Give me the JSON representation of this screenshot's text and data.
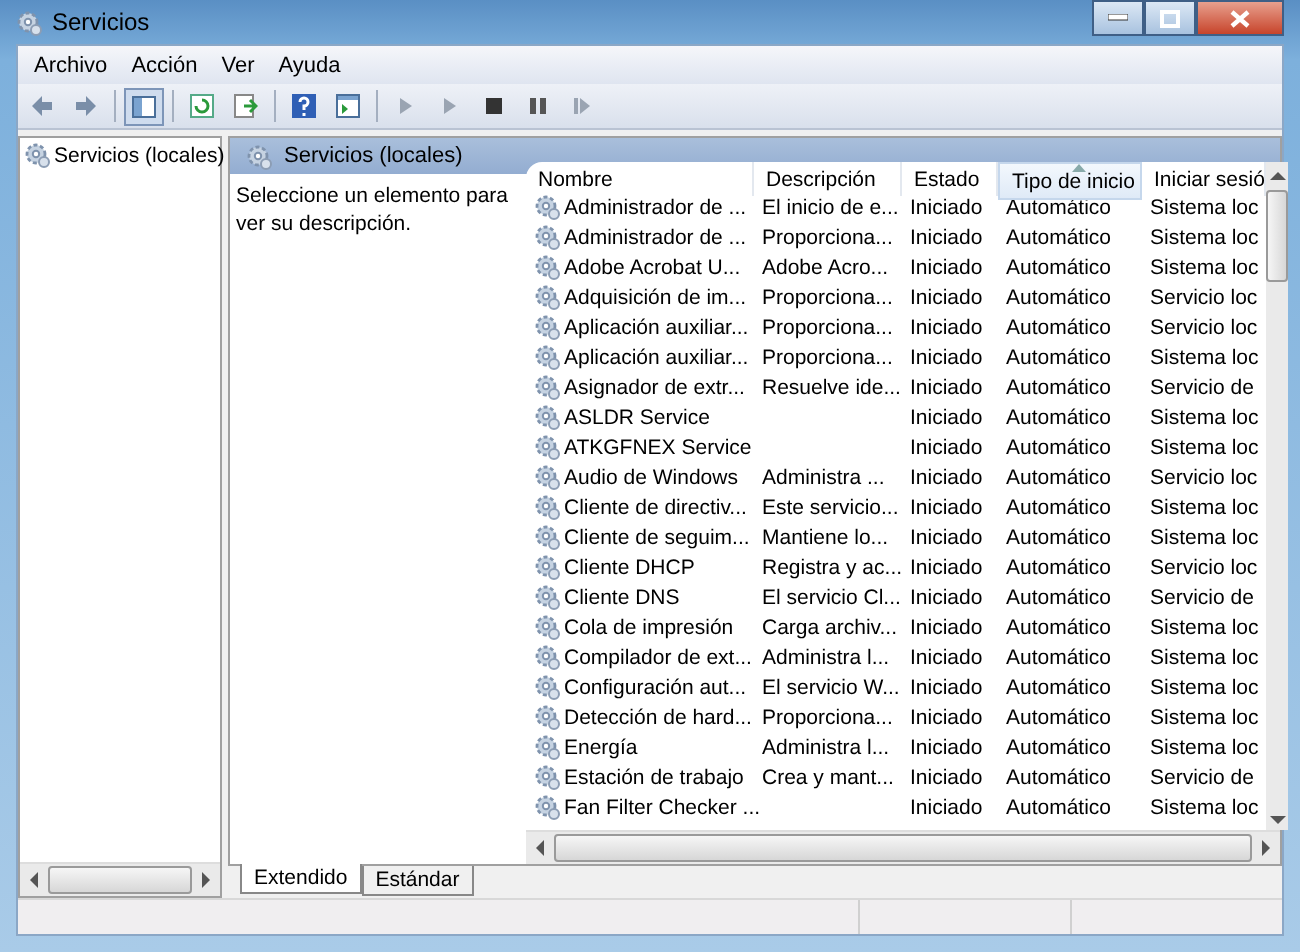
{
  "window": {
    "title": "Servicios"
  },
  "menu": [
    "Archivo",
    "Acción",
    "Ver",
    "Ayuda"
  ],
  "sidebar": {
    "items": [
      {
        "label": "Servicios (locales)",
        "selected": false
      }
    ]
  },
  "panel": {
    "title": "Servicios (locales)",
    "description": "Seleccione un elemento para ver su descripción."
  },
  "table": {
    "columns": [
      {
        "label": "Nombre",
        "sorted": false
      },
      {
        "label": "Descripción",
        "sorted": false
      },
      {
        "label": "Estado",
        "sorted": false
      },
      {
        "label": "Tipo de inicio",
        "sorted": true
      },
      {
        "label": "Iniciar sesió",
        "sorted": false
      }
    ],
    "rows": [
      {
        "name": "Administrador de ...",
        "description": "El inicio de e...",
        "status": "Iniciado",
        "startup": "Automático",
        "logon": "Sistema loc"
      },
      {
        "name": "Administrador de ...",
        "description": "Proporciona...",
        "status": "Iniciado",
        "startup": "Automático",
        "logon": "Sistema loc"
      },
      {
        "name": "Adobe Acrobat U...",
        "description": "Adobe Acro...",
        "status": "Iniciado",
        "startup": "Automático",
        "logon": "Sistema loc"
      },
      {
        "name": "Adquisición de im...",
        "description": "Proporciona...",
        "status": "Iniciado",
        "startup": "Automático",
        "logon": "Servicio loc"
      },
      {
        "name": "Aplicación auxiliar...",
        "description": "Proporciona...",
        "status": "Iniciado",
        "startup": "Automático",
        "logon": "Servicio loc"
      },
      {
        "name": "Aplicación auxiliar...",
        "description": "Proporciona...",
        "status": "Iniciado",
        "startup": "Automático",
        "logon": "Sistema loc"
      },
      {
        "name": "Asignador de extr...",
        "description": "Resuelve ide...",
        "status": "Iniciado",
        "startup": "Automático",
        "logon": "Servicio de"
      },
      {
        "name": "ASLDR Service",
        "status": "Iniciado",
        "startup": "Automático",
        "logon": "Sistema loc"
      },
      {
        "name": "ATKGFNEX Service",
        "status": "Iniciado",
        "startup": "Automático",
        "logon": "Sistema loc"
      },
      {
        "name": "Audio de Windows",
        "description": "Administra ...",
        "status": "Iniciado",
        "startup": "Automático",
        "logon": "Servicio loc"
      },
      {
        "name": "Cliente de directiv...",
        "description": "Este servicio...",
        "status": "Iniciado",
        "startup": "Automático",
        "logon": "Sistema loc"
      },
      {
        "name": "Cliente de seguim...",
        "description": "Mantiene lo...",
        "status": "Iniciado",
        "startup": "Automático",
        "logon": "Sistema loc"
      },
      {
        "name": "Cliente DHCP",
        "description": "Registra y ac...",
        "status": "Iniciado",
        "startup": "Automático",
        "logon": "Servicio loc"
      },
      {
        "name": "Cliente DNS",
        "description": "El servicio Cl...",
        "status": "Iniciado",
        "startup": "Automático",
        "logon": "Servicio de"
      },
      {
        "name": "Cola de impresión",
        "description": "Carga archiv...",
        "status": "Iniciado",
        "startup": "Automático",
        "logon": "Sistema loc"
      },
      {
        "name": "Compilador de ext...",
        "description": "Administra l...",
        "status": "Iniciado",
        "startup": "Automático",
        "logon": "Sistema loc"
      },
      {
        "name": "Configuración aut...",
        "description": "El servicio W...",
        "status": "Iniciado",
        "startup": "Automático",
        "logon": "Sistema loc"
      },
      {
        "name": "Detección de hard...",
        "description": "Proporciona...",
        "status": "Iniciado",
        "startup": "Automático",
        "logon": "Sistema loc"
      },
      {
        "name": "Energía",
        "description": "Administra l...",
        "status": "Iniciado",
        "startup": "Automático",
        "logon": "Sistema loc"
      },
      {
        "name": "Estación de trabajo",
        "description": "Crea y mant...",
        "status": "Iniciado",
        "startup": "Automático",
        "logon": "Servicio de"
      },
      {
        "name": "Fan Filter Checker ...",
        "status": "Iniciado",
        "startup": "Automático",
        "logon": "Sistema loc"
      }
    ]
  },
  "tabs": [
    {
      "label": "Extendido",
      "selected": true
    },
    {
      "label": "Estándar",
      "selected": false
    }
  ]
}
